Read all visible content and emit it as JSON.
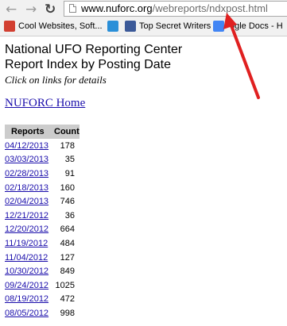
{
  "browser": {
    "url_host": "www.nuforc.org",
    "url_path": "/webreports/ndxpost.html",
    "bookmarks": [
      {
        "label": "Cool Websites, Soft...",
        "icon": "google-bookmark-icon",
        "color": "#d23f31"
      },
      {
        "label": "",
        "icon": "tab-bookmark-icon",
        "color": "#2a8fd8"
      },
      {
        "label": "Top Secret Writers",
        "icon": "facebook-bookmark-icon",
        "color": "#3b5998"
      },
      {
        "label": "ogle Docs - H",
        "icon": "docs-bookmark-icon",
        "color": "#4285f4"
      }
    ]
  },
  "page": {
    "title_line1": "National UFO Reporting Center",
    "title_line2": "Report Index by Posting Date",
    "subtitle": "Click on links for details",
    "home_link": "NUFORC Home"
  },
  "table": {
    "headers": [
      "Reports",
      "Count"
    ],
    "rows": [
      {
        "date": "04/12/2013",
        "count": "178"
      },
      {
        "date": "03/03/2013",
        "count": "35"
      },
      {
        "date": "02/28/2013",
        "count": "91"
      },
      {
        "date": "02/18/2013",
        "count": "160"
      },
      {
        "date": "02/04/2013",
        "count": "746"
      },
      {
        "date": "12/21/2012",
        "count": "36"
      },
      {
        "date": "12/20/2012",
        "count": "664"
      },
      {
        "date": "11/19/2012",
        "count": "484"
      },
      {
        "date": "11/04/2012",
        "count": "127"
      },
      {
        "date": "10/30/2012",
        "count": "849"
      },
      {
        "date": "09/24/2012",
        "count": "1025"
      },
      {
        "date": "08/19/2012",
        "count": "472"
      },
      {
        "date": "08/05/2012",
        "count": "998"
      }
    ]
  },
  "annotation": {
    "color": "#e02020"
  }
}
